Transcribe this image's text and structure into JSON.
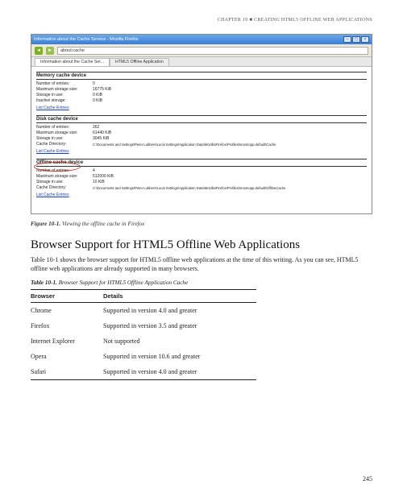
{
  "running_head": "CHAPTER 10 ■ CREATING HTML5 OFFLINE WEB APPLICATIONS",
  "screenshot": {
    "window_title": "Information about the Cache Service - Mozilla Firefox",
    "address": "about:cache",
    "tab_label": "Information about the Cache Ser...",
    "alt_tab": "HTML5 Offline Application",
    "sections": {
      "memory": {
        "title": "Memory cache device",
        "rows": [
          {
            "k": "Number of entries:",
            "v": "0"
          },
          {
            "k": "Maximum storage size:",
            "v": "16775 KiB"
          },
          {
            "k": "Storage in use:",
            "v": "0 KiB"
          },
          {
            "k": "Inactive storage:",
            "v": "0 KiB"
          }
        ],
        "link": "List Cache Entries"
      },
      "disk": {
        "title": "Disk cache device",
        "rows": [
          {
            "k": "Number of entries:",
            "v": "262"
          },
          {
            "k": "Maximum storage size:",
            "v": "61440 KiB"
          },
          {
            "k": "Storage in use:",
            "v": "3045 KiB"
          },
          {
            "k": "Cache Directory:",
            "v": "C:\\Documents and Settings\\Peter Lubbers\\Local Settings\\Application Data\\Mozilla\\Firefox\\Profiles\\sroxmopp.default\\Cache"
          }
        ],
        "link": "List Cache Entries"
      },
      "offline": {
        "title": "Offline cache device",
        "rows": [
          {
            "k": "Number of entries:",
            "v": "4"
          },
          {
            "k": "Maximum storage size:",
            "v": "512000 KiB"
          },
          {
            "k": "Storage in use:",
            "v": "10 KiB"
          },
          {
            "k": "Cache Directory:",
            "v": "C:\\Documents and Settings\\Peter Lubbers\\Local Settings\\Application Data\\Mozilla\\Firefox\\Profiles\\sroxmopp.default\\OfflineCache"
          }
        ],
        "link": "List Cache Entries"
      }
    }
  },
  "figure": {
    "lead": "Figure 10-1.",
    "text": " Viewing the offline cache in Firefox"
  },
  "section_heading": "Browser Support for HTML5 Offline Web Applications",
  "section_body": "Table 10-1 shows the browser support for HTML5 offline web applications at the time of this writing. As you can see, HTML5 offline web applications are already supported in many browsers.",
  "table": {
    "caption_lead": "Table 10-1.",
    "caption_text": " Browser Support for HTML5 Offline Application Cache",
    "headers": {
      "c1": "Browser",
      "c2": "Details"
    },
    "rows": [
      {
        "c1": "Chrome",
        "c2": "Supported in version 4.0 and greater"
      },
      {
        "c1": "Firefox",
        "c2": "Supported in version 3.5 and greater"
      },
      {
        "c1": "Internet Explorer",
        "c2": "Not supported"
      },
      {
        "c1": "Opera",
        "c2": "Supported in version 10.6 and greater"
      },
      {
        "c1": "Safari",
        "c2": "Supported in version 4.0 and greater"
      }
    ]
  },
  "page_number": "245"
}
